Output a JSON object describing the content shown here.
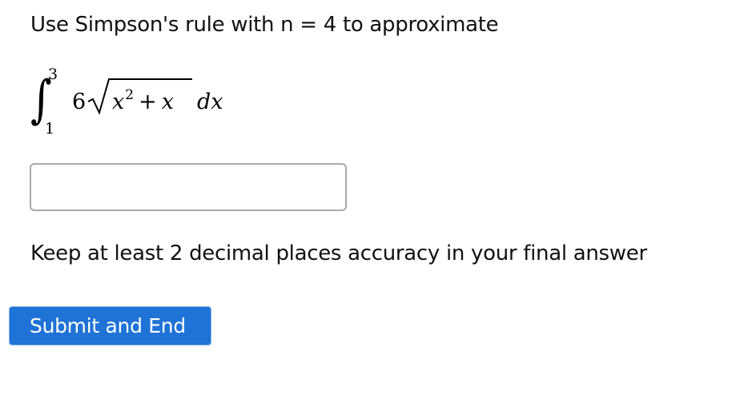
{
  "question": {
    "prompt": "Use Simpson's rule with n = 4 to approximate",
    "integral": {
      "upper_limit": "3",
      "lower_limit": "1",
      "coefficient": "6",
      "radicand_base": "x",
      "radicand_exponent": "2",
      "radicand_operator": "+",
      "radicand_term": "x",
      "differential": "dx"
    },
    "note": "Keep at least 2 decimal places accuracy in your final answer"
  },
  "answer": {
    "value": "",
    "placeholder": ""
  },
  "actions": {
    "submit_label": "Submit and End"
  },
  "colors": {
    "submit_bg": "#1f73d6",
    "input_border": "#a9a9a9"
  }
}
